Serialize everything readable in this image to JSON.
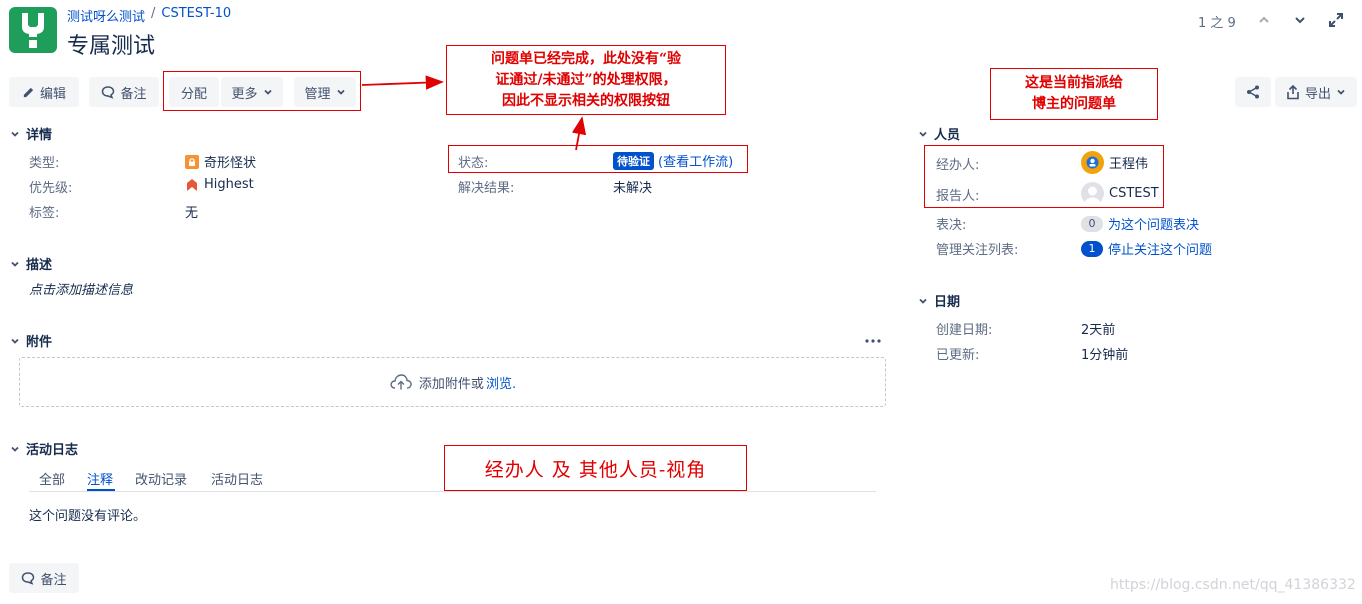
{
  "breadcrumb": {
    "project": "测试呀么测试",
    "separator": "/",
    "issue_key": "CSTEST-10"
  },
  "issue_title": "专属测试",
  "pager": {
    "text": "1 之 9"
  },
  "toolbar": {
    "edit": "编辑",
    "comment": "备注",
    "assign": "分配",
    "more": "更多",
    "admin": "管理",
    "share_icon": "share-icon",
    "export": "导出"
  },
  "details": {
    "heading": "详情",
    "type_label": "类型:",
    "type_value": "奇形怪状",
    "priority_label": "优先级:",
    "priority_value": "Highest",
    "labels_label": "标签:",
    "labels_value": "无",
    "status_label": "状态:",
    "status_value": "待验证",
    "workflow_link": "(查看工作流)",
    "resolution_label": "解决结果:",
    "resolution_value": "未解决"
  },
  "description": {
    "heading": "描述",
    "placeholder": "点击添加描述信息"
  },
  "attachments": {
    "heading": "附件",
    "drop_text": "添加附件或",
    "browse": "浏览."
  },
  "activity": {
    "heading": "活动日志",
    "tabs": [
      "全部",
      "注释",
      "改动记录",
      "活动日志"
    ],
    "active_tab": "注释",
    "empty": "这个问题没有评论。",
    "comment_button": "备注"
  },
  "people": {
    "heading": "人员",
    "assignee_label": "经办人:",
    "assignee_value": "王程伟",
    "reporter_label": "报告人:",
    "reporter_value": "CSTEST",
    "votes_label": "表决:",
    "votes_count": "0",
    "votes_link": "为这个问题表决",
    "watchers_label": "管理关注列表:",
    "watchers_count": "1",
    "watchers_link": "停止关注这个问题"
  },
  "dates": {
    "heading": "日期",
    "created_label": "创建日期:",
    "created_value": "2天前",
    "updated_label": "已更新:",
    "updated_value": "1分钟前"
  },
  "annotations": {
    "note1_line1": "问题单已经完成，此处没有“验",
    "note1_line2": "证通过/未通过”的处理权限，",
    "note1_line3": "因此不显示相关的权限按钮",
    "note2_line1": "这是当前指派给",
    "note2_line2": "博主的问题单",
    "note3": "经办人 及 其他人员-视角"
  },
  "watermark": "https://blog.csdn.net/qq_41386332",
  "colors": {
    "accent": "#0052cc",
    "annotation": "#e00000",
    "status_bg": "#0052cc",
    "logo": "#1e9e5a"
  }
}
